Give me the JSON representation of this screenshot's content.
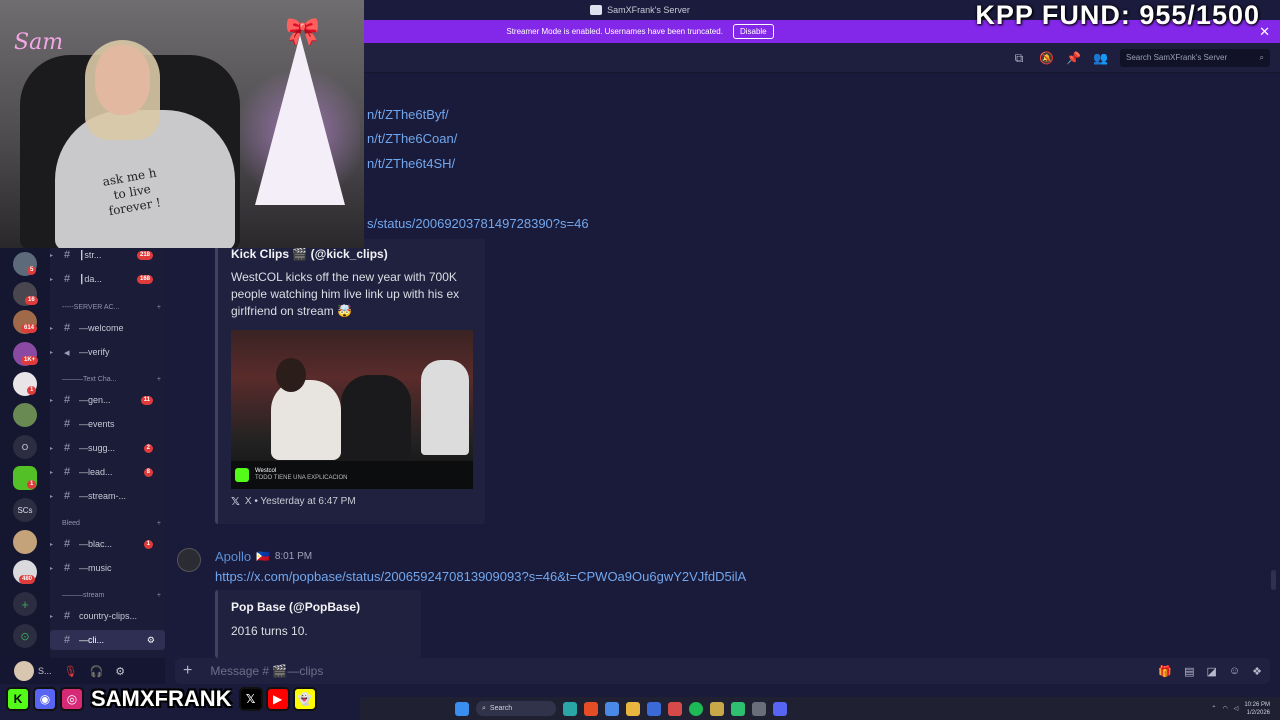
{
  "titlebar": {
    "title": "SamXFrank's Server"
  },
  "banner": {
    "text": "Streamer Mode is enabled. Usernames have been truncated.",
    "button": "Disable"
  },
  "overlay": {
    "fund": "KPP FUND: 955/1500",
    "logo": "Sam",
    "shirt_text": "ask me h\nto live\nforever !"
  },
  "header": {
    "search_placeholder": "Search SamXFrank's Server"
  },
  "rail": {
    "servers": [
      {
        "label": "",
        "badge": "5"
      },
      {
        "label": "",
        "badge": "16"
      },
      {
        "label": "",
        "badge": "614"
      },
      {
        "label": "",
        "badge": "1K+"
      },
      {
        "label": "",
        "badge": "1"
      },
      {
        "label": "",
        "badge": ""
      },
      {
        "label": "O",
        "badge": ""
      },
      {
        "label": "",
        "badge": "1"
      },
      {
        "label": "SCs",
        "badge": ""
      },
      {
        "label": "",
        "badge": ""
      },
      {
        "label": "",
        "badge": "480"
      }
    ]
  },
  "channels": {
    "items": [
      {
        "name": "┃str...",
        "count": "218",
        "icon": "megaphone-icon"
      },
      {
        "name": "┃da...",
        "count": "168",
        "icon": "pin-icon"
      },
      {
        "name": "—welcome",
        "count": "",
        "icon": "hand-icon"
      },
      {
        "name": "—verify",
        "count": "",
        "icon": "check-icon"
      },
      {
        "name": "—gen...",
        "count": "11",
        "icon": "globe-icon"
      },
      {
        "name": "—events",
        "count": "",
        "icon": "party-icon"
      },
      {
        "name": "—sugg...",
        "count": "2",
        "icon": "bubble-icon"
      },
      {
        "name": "—lead...",
        "count": "8",
        "icon": "trophy-icon"
      },
      {
        "name": "—stream-...",
        "count": "",
        "icon": "bulb-icon"
      },
      {
        "name": "—blac...",
        "count": "1",
        "icon": "face-icon"
      },
      {
        "name": "—music",
        "count": "",
        "icon": "note-icon"
      },
      {
        "name": "country-clips...",
        "count": "",
        "icon": ""
      },
      {
        "name": "—cli...",
        "count": "",
        "icon": "clip-icon"
      }
    ],
    "categories": [
      "-----SERVER AC...",
      "———Text Cha...",
      "Bleed",
      "———stream"
    ]
  },
  "user": {
    "name": "S..."
  },
  "messages": {
    "links": [
      "n/t/ZThe6tByf/",
      "n/t/ZThe6Coan/",
      "n/t/ZThe6t4SH/",
      "s/status/2006920378149728390?s=46"
    ],
    "embed1": {
      "title": "Kick Clips 🎬 (@kick_clips)",
      "description": "WestCOL kicks off the new year with 700K people watching him live link up with his ex girlfriend on stream 🤯",
      "footer": "X • Yesterday at 6:47 PM",
      "thumb_caption": "Westcol",
      "thumb_sub": "TODO TIENE UNA EXPLICACION"
    },
    "msg2": {
      "author": "Apollo",
      "flag": "🇵🇭",
      "time": "8:01 PM",
      "link": "https://x.com/popbase/status/2006592470813909093?s=46&t=CPWOa9Ou6gwY2VJfdD5ilA"
    },
    "embed2": {
      "title": "Pop Base (@PopBase)",
      "description": "2016 turns 10."
    }
  },
  "composer": {
    "placeholder": "Message # 🎬—clips"
  },
  "social": {
    "handle": "SAMXFRANK"
  },
  "taskbar": {
    "search": "Search",
    "time": "10:26 PM",
    "date": "1/2/2026"
  },
  "colors": {
    "accent": "#8327e8",
    "link": "#72a7ee",
    "badge": "#e03b3b"
  }
}
